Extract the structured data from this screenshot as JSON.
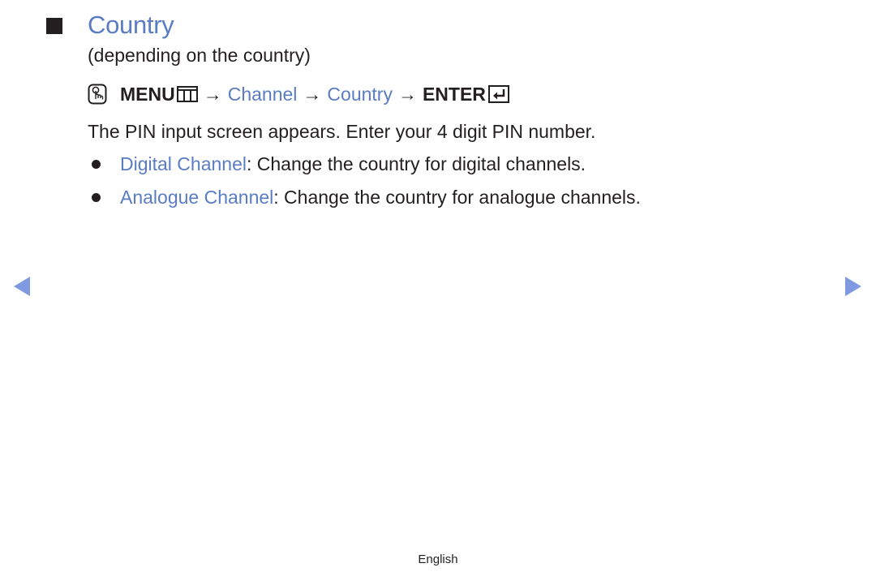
{
  "section": {
    "title": "Country",
    "subtitle": "(depending on the country)"
  },
  "path": {
    "remote_icon": "remote-hand-icon",
    "menu_label": "MENU",
    "menu_icon": "menu-grid-icon",
    "arrow": "→",
    "steps": [
      "Channel",
      "Country"
    ],
    "enter_label": "ENTER",
    "enter_icon": "enter-return-icon"
  },
  "description": "The PIN input screen appears. Enter your 4 digit PIN number.",
  "bullets": [
    {
      "term": "Digital Channel",
      "text": ": Change the country for digital channels."
    },
    {
      "term": "Analogue Channel",
      "text": ": Change the country for analogue channels."
    }
  ],
  "navigation": {
    "prev_icon": "previous-page-icon",
    "next_icon": "next-page-icon"
  },
  "footer": {
    "language": "English"
  },
  "colors": {
    "accent": "#5a7cc4",
    "nav_arrow": "#7f9ae0",
    "text": "#231f20"
  }
}
